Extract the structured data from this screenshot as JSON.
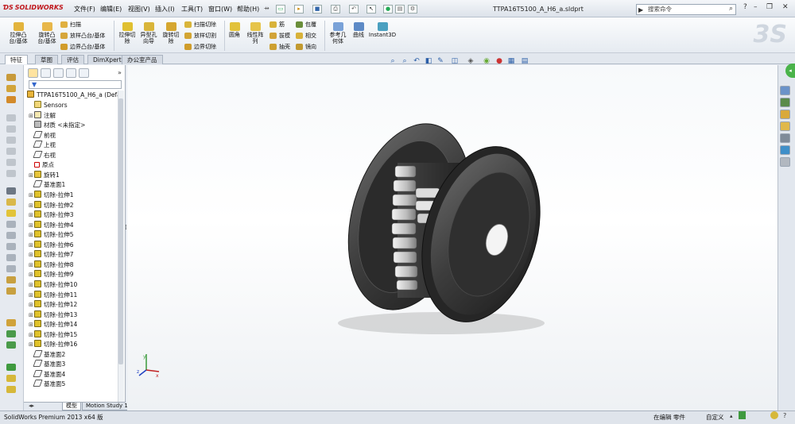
{
  "app": {
    "logo_text": "SOLIDWORKS",
    "document_title": "TTPA16T5100_A_H6_a.sldprt",
    "search_placeholder": "搜索命令"
  },
  "menu": [
    "文件(F)",
    "编辑(E)",
    "视图(V)",
    "插入(I)",
    "工具(T)",
    "窗口(W)",
    "帮助(H)"
  ],
  "commands": {
    "extrude_boss": "拉伸凸\n台/基体",
    "revolve_boss": "旋转凸\n台/基体",
    "sweep": "扫描",
    "loft_boss": "放样凸台/基体",
    "boundary_boss": "边界凸台/基体",
    "extrude_cut": "拉伸切\n除",
    "hole_wizard": "异型孔\n向导",
    "revolve_cut": "旋转切\n除",
    "swept_cut": "扫描切除",
    "lofted_cut": "放样切割",
    "boundary_cut": "边界切除",
    "fillet": "圆角",
    "linear_pattern": "线性阵\n列",
    "rib": "筋",
    "draft": "拔模",
    "shell": "抽壳",
    "wrap": "包覆",
    "intersect": "相交",
    "mirror": "镜向",
    "ref_geometry": "参考几\n何体",
    "curves": "曲线",
    "instant3d": "Instant3D"
  },
  "tabs": [
    "特征",
    "草图",
    "评估",
    "DimXpert",
    "办公室产品"
  ],
  "active_tab": "特征",
  "tree": {
    "filter_symbol": "▼",
    "root": "TTPA16T5100_A_H6_a  (Defa",
    "nodes": [
      {
        "label": "Sensors",
        "icon": "sensors-icon",
        "expandable": false
      },
      {
        "label": "注解",
        "icon": "annotations-icon",
        "expandable": true
      },
      {
        "label": "材质 <未指定>",
        "icon": "material-icon",
        "expandable": false
      },
      {
        "label": "前视",
        "icon": "plane-icon",
        "expandable": false
      },
      {
        "label": "上视",
        "icon": "plane-icon",
        "expandable": false
      },
      {
        "label": "右视",
        "icon": "plane-icon",
        "expandable": false
      },
      {
        "label": "原点",
        "icon": "origin-icon",
        "expandable": false
      },
      {
        "label": "旋转1",
        "icon": "revolve-icon",
        "expandable": true
      },
      {
        "label": "基准面1",
        "icon": "plane-icon",
        "expandable": false
      },
      {
        "label": "切除-拉伸1",
        "icon": "cut-extrude-icon",
        "expandable": true
      },
      {
        "label": "切除-拉伸2",
        "icon": "cut-extrude-icon",
        "expandable": true
      },
      {
        "label": "切除-拉伸3",
        "icon": "cut-extrude-icon",
        "expandable": true
      },
      {
        "label": "切除-拉伸4",
        "icon": "cut-extrude-icon",
        "expandable": true
      },
      {
        "label": "切除-拉伸5",
        "icon": "cut-extrude-icon",
        "expandable": true
      },
      {
        "label": "切除-拉伸6",
        "icon": "cut-extrude-icon",
        "expandable": true
      },
      {
        "label": "切除-拉伸7",
        "icon": "cut-extrude-icon",
        "expandable": true
      },
      {
        "label": "切除-拉伸8",
        "icon": "cut-extrude-icon",
        "expandable": true
      },
      {
        "label": "切除-拉伸9",
        "icon": "cut-extrude-icon",
        "expandable": true
      },
      {
        "label": "切除-拉伸10",
        "icon": "cut-extrude-icon",
        "expandable": true
      },
      {
        "label": "切除-拉伸11",
        "icon": "cut-extrude-icon",
        "expandable": true
      },
      {
        "label": "切除-拉伸12",
        "icon": "cut-extrude-icon",
        "expandable": true
      },
      {
        "label": "切除-拉伸13",
        "icon": "cut-extrude-icon",
        "expandable": true
      },
      {
        "label": "切除-拉伸14",
        "icon": "cut-extrude-icon",
        "expandable": true
      },
      {
        "label": "切除-拉伸15",
        "icon": "cut-extrude-icon",
        "expandable": true
      },
      {
        "label": "切除-拉伸16",
        "icon": "cut-extrude-icon",
        "expandable": true
      },
      {
        "label": "基准面2",
        "icon": "plane-icon",
        "expandable": false
      },
      {
        "label": "基准面3",
        "icon": "plane-icon",
        "expandable": false
      },
      {
        "label": "基准面4",
        "icon": "plane-icon",
        "expandable": false
      },
      {
        "label": "基准面5",
        "icon": "plane-icon",
        "expandable": false
      }
    ]
  },
  "bottom_tabs": [
    "模型",
    "Motion Study 1"
  ],
  "active_bottom_tab": "模型",
  "triad_labels": {
    "x": "x",
    "y": "y",
    "z": "z"
  },
  "status": {
    "product": "SolidWorks Premium 2013 x64 版",
    "mode": "在编辑 零件",
    "units": "自定义"
  },
  "colors": {
    "brand_red": "#c0161b",
    "feature_yellow": "#e0c22a",
    "model_dark": "#3a3a3a",
    "green_bubble": "#4ab34a"
  }
}
